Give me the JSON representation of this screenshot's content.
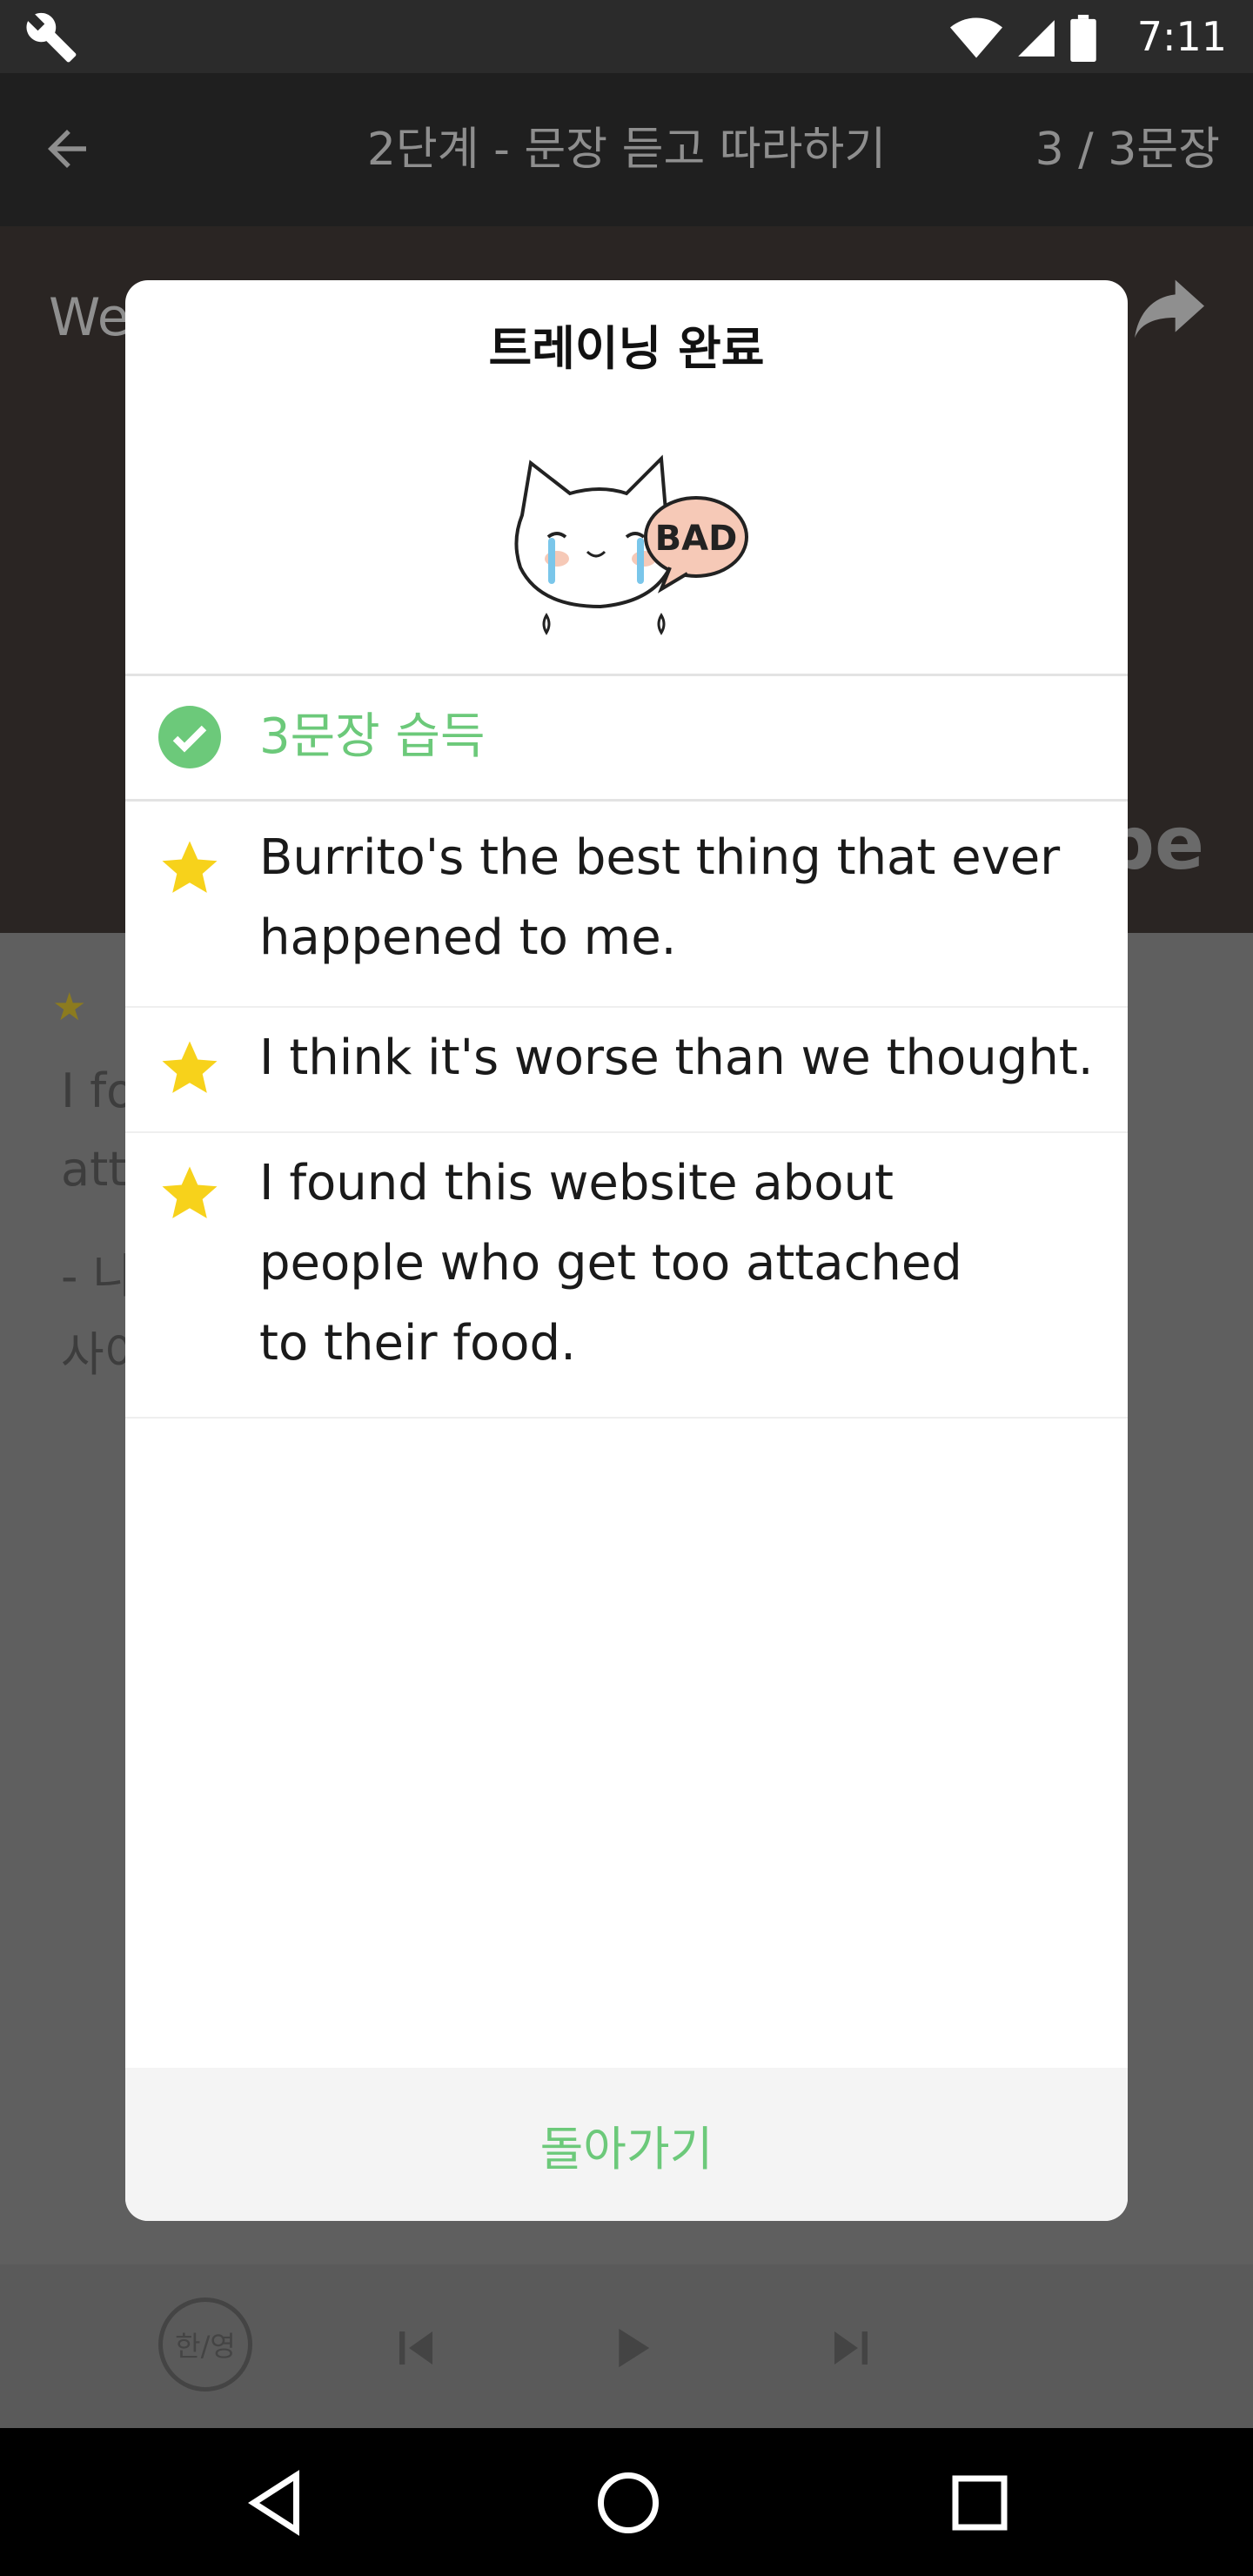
{
  "status_bar": {
    "time": "7:11",
    "icons": [
      "wrench-icon",
      "wifi-icon",
      "signal-icon",
      "battery-icon"
    ]
  },
  "app_bar": {
    "title": "2단계 - 문장 듣고 따라하기",
    "progress": "3 / 3문장"
  },
  "video": {
    "title_partial": "We",
    "brand_partial": "ube"
  },
  "background_text": {
    "line1": "I fo",
    "line2": "atta",
    "line3": "- 나",
    "line4": "사이"
  },
  "dialog": {
    "title": "트레이닝 완료",
    "mascot_badge": "BAD",
    "summary": "3문장 습득",
    "sentences": [
      "Burrito's the best thing that ever happened to me.",
      "I think it's worse than we thought.",
      "I found this website about people who get too attached to their food."
    ],
    "back_button": "돌아가기"
  },
  "controls": {
    "lang_toggle": "한/영",
    "icons": [
      "skip-previous-icon",
      "play-icon",
      "skip-next-icon"
    ]
  },
  "colors": {
    "accent_green": "#6cc97a",
    "star_yellow": "#f7d21b",
    "dialog_bg": "#ffffff",
    "footer_bg": "#f4f4f4"
  }
}
